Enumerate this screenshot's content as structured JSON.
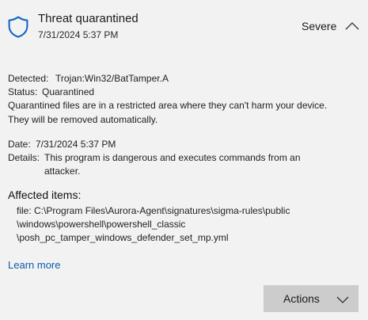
{
  "header": {
    "title": "Threat quarantined",
    "timestamp": "7/31/2024 5:37 PM",
    "severity": "Severe"
  },
  "details": {
    "detected_label": "Detected:",
    "detected_value": "Trojan:Win32/BatTamper.A",
    "status_label": "Status:",
    "status_value": "Quarantined",
    "quarantine_line1": "Quarantined files are in a restricted area where they can't harm your device.",
    "quarantine_line2": "They will be removed automatically.",
    "date_label": "Date:",
    "date_value": "7/31/2024 5:37 PM",
    "details_label": "Details:",
    "details_line1": "This program is dangerous and executes commands from an",
    "details_line2": "attacker."
  },
  "affected": {
    "title": "Affected items:",
    "file_line1": "file: C:\\Program Files\\Aurora-Agent\\signatures\\sigma-rules\\public",
    "file_line2": "\\windows\\powershell\\powershell_classic",
    "file_line3": "\\posh_pc_tamper_windows_defender_set_mp.yml"
  },
  "links": {
    "learn_more": "Learn more"
  },
  "buttons": {
    "actions_label": "Actions"
  },
  "icons": {
    "shield": "shield-icon",
    "collapse": "chevron-up-icon",
    "actions": "chevron-down-icon"
  },
  "colors": {
    "background": "#f2f2f2",
    "accent": "#0b5cad",
    "button": "#cccccc"
  }
}
